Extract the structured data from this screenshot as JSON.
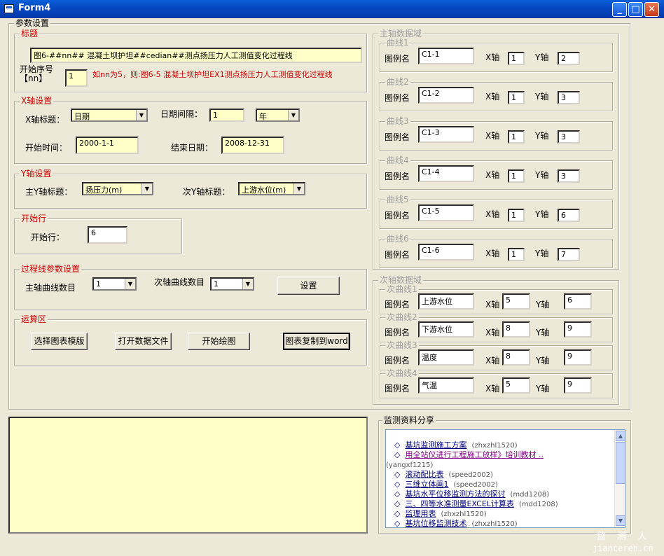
{
  "window": {
    "title": "Form4"
  },
  "params_frame": {
    "legend": "参数设置"
  },
  "title_group": {
    "legend": "标题",
    "title_value": "图6-##nn##   混凝土坝护坦##cedian##测点扬压力人工测值变化过程线",
    "start_label": "开始序号",
    "nn_label": "【nn】",
    "start_value": "1",
    "hint": "如nn为5，则:图6-5   混凝土坝护坦EX1测点扬压力人工测值变化过程线"
  },
  "x_axis": {
    "legend": "X轴设置",
    "title_label": "X轴标题：",
    "title_value": "日期",
    "interval_label": "日期间隔：",
    "interval_value": "1",
    "unit_value": "年",
    "start_label": "开始时间：",
    "start_value": "2000-1-1",
    "end_label": "结束日期：",
    "end_value": "2008-12-31"
  },
  "y_axis": {
    "legend": "Y轴设置",
    "main_label": "主Y轴标题：",
    "main_value": "扬压力(m)",
    "sub_label": "次Y轴标题：",
    "sub_value": "上游水位(m)"
  },
  "start_row": {
    "legend": "开始行",
    "label": "开始行：",
    "value": "6"
  },
  "process": {
    "legend": "过程线参数设置",
    "main_label": "主轴曲线数目",
    "main_value": "1",
    "sub_label": "次轴曲线数目",
    "sub_value": "1",
    "setup_button": "设置"
  },
  "compute": {
    "legend": "运算区",
    "btn_template": "选择图表模版",
    "btn_open": "打开数据文件",
    "btn_draw": "开始绘图",
    "btn_copy": "图表复制到word"
  },
  "main_axis": {
    "legend": "主轴数据域",
    "legend_label": "图例名",
    "x_label": "X轴",
    "y_label": "Y轴",
    "curves": [
      {
        "legend": "曲线1",
        "name": "C1-1",
        "x": "1",
        "y": "2"
      },
      {
        "legend": "曲线2",
        "name": "C1-2",
        "x": "1",
        "y": "3"
      },
      {
        "legend": "曲线3",
        "name": "C1-3",
        "x": "1",
        "y": "3"
      },
      {
        "legend": "曲线4",
        "name": "C1-4",
        "x": "1",
        "y": "3"
      },
      {
        "legend": "曲线5",
        "name": "C1-5",
        "x": "1",
        "y": "6"
      },
      {
        "legend": "曲线6",
        "name": "C1-6",
        "x": "1",
        "y": "7"
      }
    ]
  },
  "sub_axis": {
    "legend": "次轴数据域",
    "curves": [
      {
        "legend": "次曲线1",
        "name": "上游水位",
        "x": "5",
        "y": "6"
      },
      {
        "legend": "次曲线2",
        "name": "下游水位",
        "x": "8",
        "y": "9"
      },
      {
        "legend": "次曲线3",
        "name": "温度",
        "x": "8",
        "y": "9"
      },
      {
        "legend": "次曲线4",
        "name": "气温",
        "x": "5",
        "y": "9"
      }
    ]
  },
  "share": {
    "legend": "监测资料分享",
    "items": [
      {
        "title": "基坑监测施工方案",
        "user": "(zhxzhl1520)"
      },
      {
        "title": "用全站仪进行工程施工放样》培训教材 ..",
        "user": "(yangxf1215)"
      },
      {
        "title": "滚动配比表",
        "user": "(speed2002)"
      },
      {
        "title": "三维立体画1",
        "user": "(speed2002)"
      },
      {
        "title": "基坑水平位移监测方法的探讨",
        "user": "(mdd1208)"
      },
      {
        "title": "三、四等水准测量EXCEL计算表",
        "user": "(mdd1208)"
      },
      {
        "title": "监理用表",
        "user": "(zhxzhl1520)"
      },
      {
        "title": "基坑位移监测技术",
        "user": "(zhxzhl1520)"
      }
    ]
  },
  "watermark": {
    "top": "监 测 人",
    "bottom": "jianceren.cn"
  },
  "icons": {
    "bullet": "diamond-icon",
    "minimize": "minimize-icon",
    "maximize": "maximize-icon",
    "close": "close-icon"
  }
}
